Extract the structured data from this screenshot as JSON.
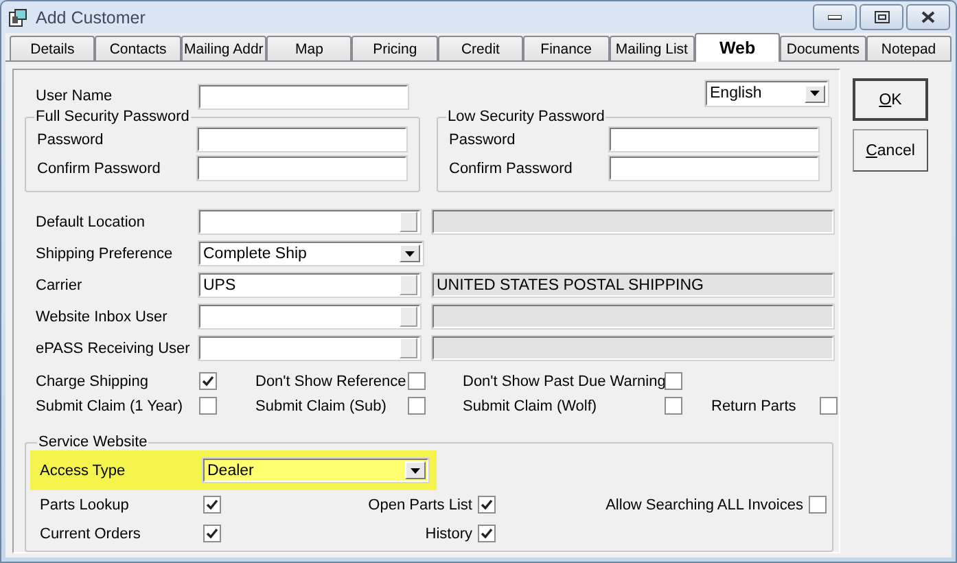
{
  "window": {
    "title": "Add Customer"
  },
  "tabs": [
    {
      "label": "Details",
      "selected": false
    },
    {
      "label": "Contacts",
      "selected": false
    },
    {
      "label": "Mailing Addr",
      "selected": false
    },
    {
      "label": "Map",
      "selected": false
    },
    {
      "label": "Pricing",
      "selected": false
    },
    {
      "label": "Credit",
      "selected": false
    },
    {
      "label": "Finance",
      "selected": false
    },
    {
      "label": "Mailing List",
      "selected": false
    },
    {
      "label": "Web",
      "selected": true
    },
    {
      "label": "Documents",
      "selected": false
    },
    {
      "label": "Notepad",
      "selected": false
    }
  ],
  "user_name": {
    "label": "User Name"
  },
  "language": {
    "value": "English"
  },
  "password_groups": [
    {
      "title": "Full Security Password",
      "fields": [
        {
          "label": "Password"
        },
        {
          "label": "Confirm Password"
        }
      ]
    },
    {
      "title": "Low Security Password",
      "fields": [
        {
          "label": "Password"
        },
        {
          "label": "Confirm Password"
        }
      ]
    }
  ],
  "lookups": [
    {
      "kind": "lookup",
      "label": "Default Location"
    },
    {
      "kind": "combo",
      "label": "Shipping Preference",
      "value": "Complete Ship"
    },
    {
      "kind": "lookup",
      "label": "Carrier",
      "value": "UPS",
      "description": "UNITED STATES POSTAL SHIPPING"
    },
    {
      "kind": "lookup",
      "label": "Website Inbox User"
    },
    {
      "kind": "lookup",
      "label": "ePASS Receiving User"
    }
  ],
  "option_rows": [
    {
      "items": [
        {
          "label": "Charge Shipping",
          "checked": true
        },
        {
          "label": "Don't Show Reference",
          "checked": false
        },
        {
          "label": "Don't Show Past Due Warning",
          "checked": false
        }
      ]
    },
    {
      "items": [
        {
          "label": "Submit Claim (1 Year)",
          "checked": false
        },
        {
          "label": "Submit Claim (Sub)",
          "checked": false
        },
        {
          "label": "Submit Claim (Wolf)",
          "checked": false
        },
        {
          "label": "Return Parts",
          "checked": false
        }
      ]
    }
  ],
  "service_website": {
    "title": "Service Website",
    "access_type": {
      "label": "Access Type",
      "value": "Dealer",
      "highlighted": true
    },
    "options": [
      {
        "label": "Parts Lookup",
        "checked": true
      },
      {
        "label": "Open Parts List",
        "checked": true
      },
      {
        "label": "Allow Searching ALL Invoices",
        "checked": false
      },
      {
        "label": "Current Orders",
        "checked": true
      },
      {
        "label": "History",
        "checked": true
      }
    ]
  },
  "buttons": [
    {
      "label": "OK",
      "default": true
    },
    {
      "label": "Cancel",
      "default": false
    }
  ]
}
